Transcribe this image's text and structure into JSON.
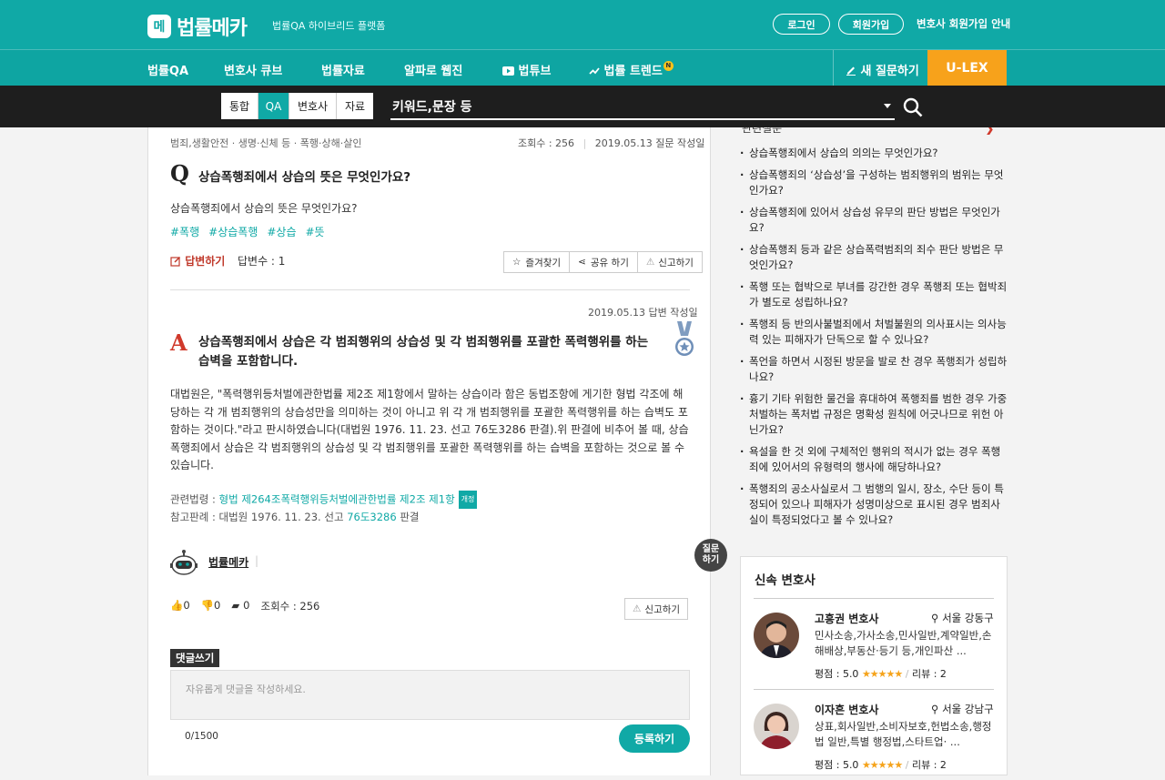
{
  "header": {
    "logo_mark": "메",
    "logo_text": "법률메카",
    "logo_sub": "법률QA 하이브리드 플랫폼",
    "login": "로그인",
    "signup": "회원가입",
    "lawyer_signup": "변호사 회원가입 안내"
  },
  "nav": {
    "items": [
      "법률QA",
      "변호사 큐브",
      "법률자료",
      "알파로 웹진",
      "법튜브",
      "법률 트렌드"
    ],
    "trend_badge": "N",
    "new_question": "새 질문하기",
    "ulex": "U-LEX"
  },
  "search": {
    "tabs": [
      "통합",
      "QA",
      "변호사",
      "자료"
    ],
    "active_tab": "QA",
    "placeholder": "키워드,문장 등"
  },
  "question": {
    "category": "범죄,생활안전 · 생명·신체 등 · 폭행·상해·살인",
    "views": "조회수 : 256",
    "date": "2019.05.13 질문 작성일",
    "q_mark": "Q",
    "title": "상습폭행죄에서 상습의 뜻은 무엇인가요?",
    "body": "상습폭행죄에서 상습의 뜻은 무엇인가요?",
    "tags": [
      "#폭행",
      "#상습폭행",
      "#상습",
      "#뜻"
    ],
    "answer_button": "답변하기",
    "answer_count": "답변수 : 1",
    "actions": [
      "즐겨찾기",
      "공유 하기",
      "신고하기"
    ]
  },
  "answer": {
    "date": "2019.05.13 답변 작성일",
    "a_mark": "A",
    "title": "상습폭행죄에서 상습은 각 범죄행위의 상습성 및 각 범죄행위를 포괄한 폭력행위를 하는 습벽을 포함합니다.",
    "body": "대법원은, \"폭력행위등처벌에관한법률 제2조 제1항에서 말하는 상습이라 함은 동법조항에 게기한 형법 각조에 해당하는 각 개 범죄행위의 상습성만을 의미하는 것이 아니고 위 각 개 범죄행위를 포괄한 폭력행위를 하는 습벽도 포함하는 것이다.\"라고 판시하였습니다(대법원 1976. 11. 23. 선고 76도3286 판결).위 판결에 비추어 볼 때, 상습폭행죄에서 상습은 각 범죄행위의 상습성 및 각 범죄행위를 포괄한 폭력행위를 하는 습벽을 포함하는 것으로 볼 수 있습니다.",
    "related_law_label": "관련법령 : ",
    "related_law": "형법 제264조폭력행위등처벌에관한법률 제2조 제1항",
    "related_law_tag": "개정",
    "ref_case_label": "참고판례 : 대법원 1976. 11. 23. 선고 ",
    "ref_case_link": "76도3286",
    "ref_case_suffix": " 판결",
    "author": "법률메카",
    "author_sep": "|",
    "likes": "0",
    "dislikes": "0",
    "comments": "0",
    "views": "조회수 : 256",
    "report": "신고하기"
  },
  "comment": {
    "label": "댓글쓰기",
    "placeholder": "자유롭게 댓글을 작성하세요.",
    "count": "0/1500",
    "submit": "등록하기"
  },
  "float_question": {
    "line1": "질문",
    "line2": "하기"
  },
  "related": {
    "heading": "관련질문",
    "items": [
      "상습폭행죄에서 상습의 의의는 무엇인가요?",
      "상습폭행죄의 ‘상습성’을 구성하는 범죄행위의 범위는 무엇인가요?",
      "상습폭행죄에 있어서 상습성 유무의 판단 방법은 무엇인가요?",
      "상습폭행죄 등과 같은 상습폭력범죄의 죄수 판단 방법은 무엇인가요?",
      "폭행 또는 협박으로 부녀를 강간한 경우 폭행죄 또는 협박죄가 별도로 성립하나요?",
      "폭행죄 등 반의사불벌죄에서 처벌불원의 의사표시는 의사능력 있는 피해자가 단독으로 할 수 있나요?",
      "폭언을 하면서 시정된 방문을 발로 찬 경우 폭행죄가 성립하나요?",
      "흉기 기타 위험한 물건을 휴대하여 폭행죄를 범한 경우 가중처벌하는 폭처법 규정은 명확성 원칙에 어긋나므로 위헌 아닌가요?",
      "욕설을 한 것 외에 구체적인 행위의 적시가 없는 경우 폭행죄에 있어서의 유형력의 행사에 해당하나요?",
      "폭행죄의 공소사실로서 그 범행의 일시, 장소, 수단 등이 특정되어 있으나 피해자가 성명미상으로 표시된 경우 범죄사실이 특정되었다고 볼 수 있나요?"
    ]
  },
  "lawyers": {
    "title": "신속 변호사",
    "list": [
      {
        "name": "고흥권 변호사",
        "location": "서울 강동구",
        "specialty": "민사소송,가사소송,민사일반,계약일반,손해배상,부동산·등기 등,개인파산 ...",
        "rating_label": "평점 : 5.0",
        "stars": "★★★★★",
        "reviews": "리뷰 : 2"
      },
      {
        "name": "이자흔 변호사",
        "location": "서울 강남구",
        "specialty": "상표,회사일반,소비자보호,헌법소송,행정법 일반,특별 행정법,스타트업· ...",
        "rating_label": "평점 : 5.0",
        "stars": "★★★★★",
        "reviews": "리뷰 : 2"
      }
    ]
  },
  "colors": {
    "brand": "#10a9a6",
    "accent": "#f7a21b",
    "answer_red": "#d0392b"
  }
}
